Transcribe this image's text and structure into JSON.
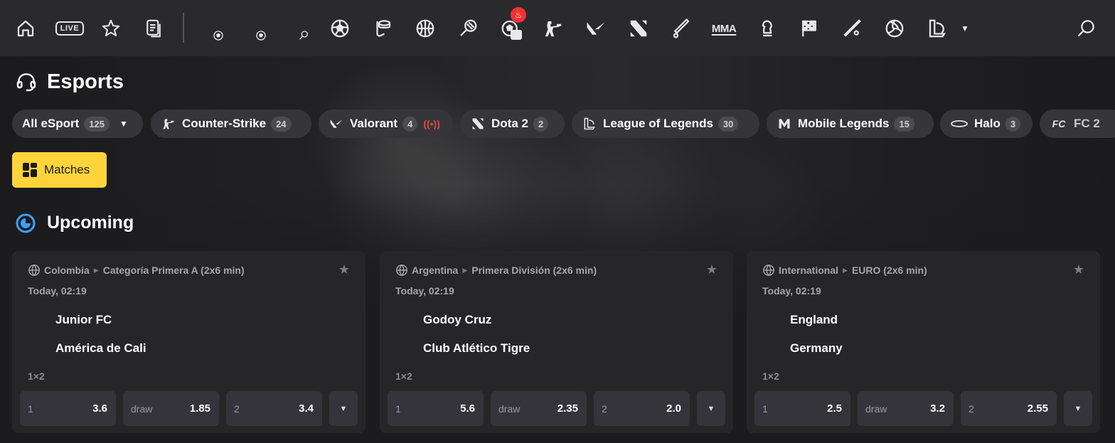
{
  "nav": {
    "live_label": "LIVE",
    "mma_label": "MMA",
    "icons": [
      "home-icon",
      "live-icon",
      "star-icon",
      "betslip-icon",
      "soccer-small-icon",
      "soccer-small-icon",
      "tennis-small-icon",
      "soccer-icon",
      "hockey-icon",
      "basketball-icon",
      "tennis-icon",
      "esoccer-icon",
      "counter-strike-icon",
      "valorant-icon",
      "dota2-icon",
      "cricket-icon",
      "mma-icon",
      "chess-icon",
      "racing-flag-icon",
      "baseball-icon",
      "volleyball-icon",
      "league-of-legends-icon",
      "chevron-down-icon",
      "search-icon"
    ]
  },
  "page": {
    "title": "Esports"
  },
  "filters": [
    {
      "label": "All eSport",
      "count": "125"
    },
    {
      "label": "Counter-Strike",
      "count": "24"
    },
    {
      "label": "Valorant",
      "count": "4"
    },
    {
      "label": "Dota 2",
      "count": "2"
    },
    {
      "label": "League of Legends",
      "count": "30"
    },
    {
      "label": "Mobile Legends",
      "count": "15"
    },
    {
      "label": "Halo",
      "count": "3"
    },
    {
      "label": "FC 2",
      "count": ""
    }
  ],
  "matches_button": {
    "label": "Matches"
  },
  "section": {
    "title": "Upcoming"
  },
  "cards": [
    {
      "country": "Colombia",
      "league": "Categoría Primera A (2x6 min)",
      "time": "Today, 02:19",
      "team1": "Junior FC",
      "team2": "América de Cali",
      "market": "1×2",
      "odds": [
        {
          "label": "1",
          "value": "3.6"
        },
        {
          "label": "draw",
          "value": "1.85"
        },
        {
          "label": "2",
          "value": "3.4"
        }
      ]
    },
    {
      "country": "Argentina",
      "league": "Primera División (2x6 min)",
      "time": "Today, 02:19",
      "team1": "Godoy Cruz",
      "team2": "Club Atlético Tigre",
      "market": "1×2",
      "odds": [
        {
          "label": "1",
          "value": "5.6"
        },
        {
          "label": "draw",
          "value": "2.35"
        },
        {
          "label": "2",
          "value": "2.0"
        }
      ]
    },
    {
      "country": "International",
      "league": "EURO (2x6 min)",
      "time": "Today, 02:19",
      "team1": "England",
      "team2": "Germany",
      "market": "1×2",
      "odds": [
        {
          "label": "1",
          "value": "2.5"
        },
        {
          "label": "draw",
          "value": "3.2"
        },
        {
          "label": "2",
          "value": "2.55"
        }
      ]
    }
  ],
  "colors": {
    "accent": "#ffd43b",
    "live": "#e2463f",
    "upcoming": "#3aa0ff",
    "card": "#262628"
  }
}
